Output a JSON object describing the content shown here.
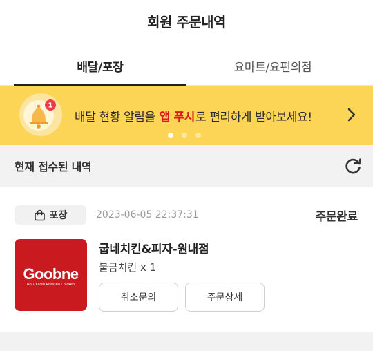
{
  "header": {
    "title": "회원 주문내역"
  },
  "tabs": [
    {
      "label": "배달/포장",
      "active": true
    },
    {
      "label": "요마트/요편의점",
      "active": false
    }
  ],
  "banner": {
    "text_before": "배달 현황 알림을",
    "highlight": "앱 푸시",
    "text_after": "로 편리하게 받아보세요!",
    "badge_count": "1",
    "arrow_icon": "chevron-right-icon",
    "pages": 3,
    "current_page": 1,
    "background": "#fcd456",
    "highlight_color": "#e01b1b"
  },
  "section": {
    "label": "현재 접수된 내역",
    "refresh_icon": "refresh-icon"
  },
  "order": {
    "type_label": "포장",
    "type_icon": "shopping-bag-icon",
    "datetime": "2023-06-05 22:37:31",
    "status": "주문완료",
    "store_name": "굽네치킨&피자-원내점",
    "item_summary": "불금치킨 x 1",
    "logo": {
      "brand": "Goobne",
      "tagline": "No.1 Oven Roasted Chicken",
      "color": "#c81a1f"
    },
    "actions": {
      "cancel": "취소문의",
      "detail": "주문상세"
    }
  }
}
